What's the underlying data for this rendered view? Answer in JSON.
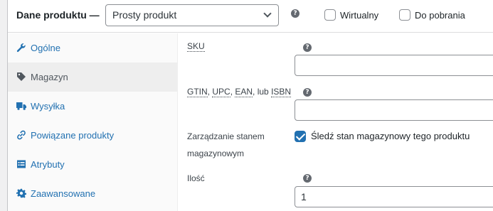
{
  "header": {
    "title": "Dane produktu —",
    "product_type": {
      "selected": "Prosty produkt"
    },
    "virtual": {
      "label": "Wirtualny",
      "checked": false
    },
    "downloadable": {
      "label": "Do pobrania",
      "checked": false
    },
    "help_glyph": "?"
  },
  "sidebar": {
    "items": [
      {
        "label": "Ogólne",
        "icon": "wrench-icon",
        "active": false
      },
      {
        "label": "Magazyn",
        "icon": "tag-icon",
        "active": true
      },
      {
        "label": "Wysyłka",
        "icon": "truck-icon",
        "active": false
      },
      {
        "label": "Powiązane produkty",
        "icon": "link-icon",
        "active": false
      },
      {
        "label": "Atrybuty",
        "icon": "list-icon",
        "active": false
      },
      {
        "label": "Zaawansowane",
        "icon": "gear-icon",
        "active": false
      }
    ]
  },
  "inventory": {
    "sku": {
      "label": "SKU",
      "value": ""
    },
    "gtin": {
      "label_parts": [
        "GTIN",
        ", ",
        "UPC",
        ", ",
        "EAN",
        ", lub ",
        "ISBN"
      ],
      "value": ""
    },
    "manage_stock": {
      "label_line1": "Zarządzanie stanem",
      "label_line2": "magazynowym",
      "checkbox_text": "Śledź stan magazynowy tego produktu",
      "checked": true
    },
    "quantity": {
      "label": "Ilość",
      "value": "1"
    }
  },
  "colors": {
    "link": "#2271b1",
    "checkbox_checked": "#2271b1",
    "border": "#8c8f94"
  }
}
